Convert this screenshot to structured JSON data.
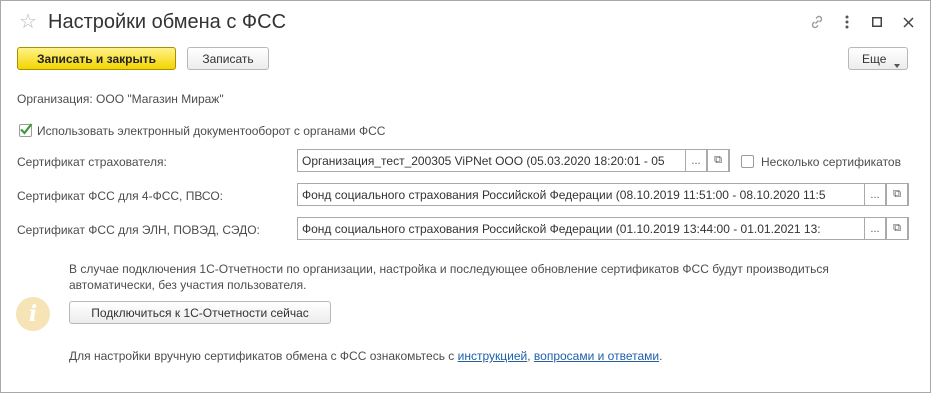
{
  "window": {
    "title": "Настройки обмена с ФСС",
    "icons": [
      "star-icon",
      "link-icon",
      "more-vertical-icon",
      "maximize-icon",
      "close-icon"
    ]
  },
  "toolbar": {
    "save_close_label": "Записать и закрыть",
    "save_label": "Записать",
    "more_label": "Еще"
  },
  "organization": {
    "text": "Организация: ООО \"Магазин Мираж\""
  },
  "use_edo": {
    "label": "Использовать электронный документооборот с органами ФСС",
    "checked": true
  },
  "fields": {
    "insurer_cert": {
      "label": "Сертификат страхователя:",
      "value": "Организация_тест_200305 ViPNet ООО (05.03.2020 18:20:01 - 05"
    },
    "multiple_certs": {
      "label": "Несколько сертификатов",
      "checked": false
    },
    "fss_cert_4fss": {
      "label": "Сертификат ФСС для 4-ФСС, ПВСО:",
      "value": "Фонд социального страхования Российской Федерации (08.10.2019 11:51:00 - 08.10.2020 11:5"
    },
    "fss_cert_eln": {
      "label": "Сертификат ФСС для ЭЛН, ПОВЭД, СЭДО:",
      "value": "Фонд социального страхования Российской Федерации (01.10.2019 13:44:00 - 01.01.2021 13:"
    },
    "choose_glyph": "...",
    "open_glyph": "⧉"
  },
  "info": {
    "icon_glyph": "i",
    "line1": "В случае подключения 1С-Отчетности по организации, настройка и последующее обновление сертификатов ФСС будут производиться",
    "line2": "автоматически, без участия пользователя.",
    "connect_button": "Подключиться к 1С-Отчетности сейчас"
  },
  "footer": {
    "text": "Для настройки вручную сертификатов обмена с ФСС ознакомьтесь с",
    "link1": "инструкцией",
    "separator": ",",
    "link2": "вопросами и ответами",
    "end": "."
  }
}
